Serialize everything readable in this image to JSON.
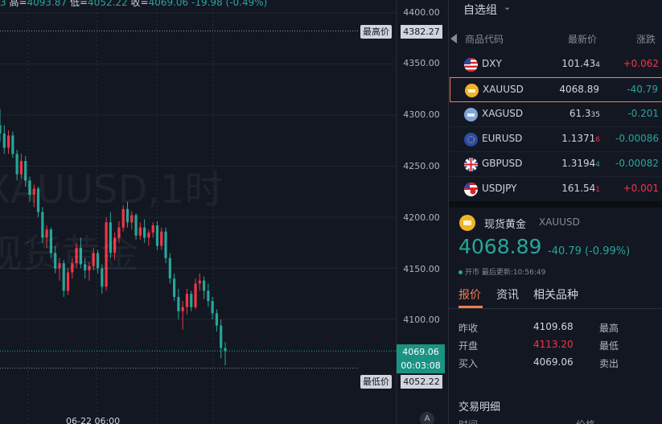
{
  "ohlc": {
    "partial_lead": "3",
    "high_label": "高=",
    "high": "4093.87",
    "low_label": "低=",
    "low": "4052.22",
    "close_label": "收=",
    "close": "4069.06",
    "change": "-19.98",
    "change_pct": "(-0.49%)"
  },
  "watermark": {
    "line1": "XAUUSD,1时",
    "line2": "现货黄金"
  },
  "price_axis": {
    "ticks": [
      "4400.00",
      "4350.00",
      "4300.00",
      "4250.00",
      "4200.00",
      "4150.00",
      "4100.00"
    ],
    "high_tag_label": "最高价",
    "high_tag_value": "4382.27",
    "low_tag_label": "最低价",
    "low_tag_value": "4052.22",
    "current_price": "4069.06",
    "countdown": "00:03:08",
    "time_label": "06-22 06:00",
    "auto_button": "A"
  },
  "chart_data": {
    "type": "candlestick",
    "symbol": "XAUUSD",
    "interval": "1时",
    "ylim": [
      4050,
      4410
    ],
    "yticks": [
      4100,
      4150,
      4200,
      4250,
      4300,
      4350,
      4400
    ],
    "series": [
      {
        "values": [
          [
            4290,
            4306,
            4274,
            4282
          ],
          [
            4282,
            4290,
            4262,
            4268
          ],
          [
            4268,
            4285,
            4262,
            4280
          ],
          [
            4280,
            4284,
            4258,
            4262
          ],
          [
            4262,
            4266,
            4236,
            4242
          ],
          [
            4242,
            4262,
            4238,
            4255
          ],
          [
            4255,
            4260,
            4230,
            4236
          ],
          [
            4236,
            4240,
            4215,
            4222
          ],
          [
            4222,
            4232,
            4210,
            4228
          ],
          [
            4228,
            4230,
            4200,
            4205
          ],
          [
            4205,
            4210,
            4175,
            4180
          ],
          [
            4180,
            4192,
            4170,
            4188
          ],
          [
            4188,
            4190,
            4160,
            4165
          ],
          [
            4165,
            4172,
            4145,
            4150
          ],
          [
            4150,
            4160,
            4138,
            4155
          ],
          [
            4155,
            4158,
            4122,
            4128
          ],
          [
            4128,
            4150,
            4124,
            4146
          ],
          [
            4146,
            4160,
            4140,
            4155
          ],
          [
            4155,
            4175,
            4150,
            4170
          ],
          [
            4170,
            4180,
            4150,
            4154
          ],
          [
            4154,
            4160,
            4140,
            4148
          ],
          [
            4148,
            4156,
            4138,
            4152
          ],
          [
            4152,
            4170,
            4148,
            4165
          ],
          [
            4165,
            4168,
            4145,
            4150
          ],
          [
            4150,
            4154,
            4125,
            4132
          ],
          [
            4132,
            4200,
            4128,
            4195
          ],
          [
            4195,
            4205,
            4160,
            4165
          ],
          [
            4165,
            4185,
            4158,
            4180
          ],
          [
            4180,
            4196,
            4175,
            4190
          ],
          [
            4190,
            4212,
            4186,
            4208
          ],
          [
            4208,
            4215,
            4190,
            4195
          ],
          [
            4195,
            4206,
            4188,
            4202
          ],
          [
            4202,
            4204,
            4178,
            4182
          ],
          [
            4182,
            4195,
            4178,
            4190
          ],
          [
            4190,
            4198,
            4175,
            4180
          ],
          [
            4180,
            4188,
            4172,
            4185
          ],
          [
            4185,
            4195,
            4180,
            4192
          ],
          [
            4192,
            4196,
            4168,
            4172
          ],
          [
            4172,
            4190,
            4168,
            4186
          ],
          [
            4186,
            4190,
            4155,
            4160
          ],
          [
            4160,
            4165,
            4135,
            4140
          ],
          [
            4140,
            4145,
            4118,
            4122
          ],
          [
            4122,
            4130,
            4100,
            4108
          ],
          [
            4108,
            4118,
            4090,
            4112
          ],
          [
            4112,
            4130,
            4105,
            4125
          ],
          [
            4125,
            4128,
            4108,
            4112
          ],
          [
            4112,
            4140,
            4110,
            4135
          ],
          [
            4135,
            4145,
            4128,
            4138
          ],
          [
            4138,
            4142,
            4120,
            4128
          ],
          [
            4128,
            4135,
            4112,
            4118
          ],
          [
            4118,
            4122,
            4100,
            4106
          ],
          [
            4106,
            4110,
            4088,
            4094
          ],
          [
            4094,
            4100,
            4062,
            4072
          ],
          [
            4072,
            4078,
            4055,
            4069
          ]
        ]
      }
    ],
    "high_marker": 4382.27,
    "low_marker": 4052.22,
    "last_price": 4069.06
  },
  "watchlist": {
    "title": "自选组",
    "headers": {
      "symbol": "商品代码",
      "last": "最新价",
      "change": "涨跌"
    },
    "rows": [
      {
        "symbol": "DXY",
        "last_main": "101.43",
        "last_tail": "4",
        "change": "+0.062",
        "dir": "up",
        "icon": "us-flag-icon"
      },
      {
        "symbol": "XAUUSD",
        "last_main": "4068.89",
        "last_tail": "",
        "change": "-40.79",
        "dir": "dn",
        "icon": "gold-icon"
      },
      {
        "symbol": "XAGUSD",
        "last_main": "61.3",
        "last_tail": "35",
        "change": "-0.201",
        "dir": "dn",
        "icon": "silver-icon"
      },
      {
        "symbol": "EURUSD",
        "last_main": "1.1371",
        "last_tail": "6",
        "change": "-0.00086",
        "dir": "dn",
        "icon": "eu-us-flag-icon"
      },
      {
        "symbol": "GBPUSD",
        "last_main": "1.3194",
        "last_tail": "4",
        "change": "-0.00082",
        "dir": "dn",
        "icon": "gb-us-flag-icon"
      },
      {
        "symbol": "USDJPY",
        "last_main": "161.54",
        "last_tail": "1",
        "change": "+0.001",
        "dir": "up",
        "icon": "us-jp-flag-icon"
      }
    ]
  },
  "detail": {
    "name": "现货黄金",
    "code": "XAUUSD",
    "price": "4068.89",
    "change": "-40.79 (-0.99%)",
    "status": "开市",
    "updated": "最后更新:10:56:49",
    "tabs": [
      "报价",
      "资讯",
      "相关品种"
    ],
    "quote": {
      "prev_close_label": "昨收",
      "prev_close": "4109.68",
      "high_label": "最高",
      "open_label": "开盘",
      "open": "4113.20",
      "low_label": "最低",
      "bid_label": "买入",
      "bid": "4069.06",
      "ask_label": "卖出"
    },
    "trades_title": "交易明细",
    "trades_headers": {
      "time": "时间",
      "price": "价格"
    }
  },
  "colors": {
    "up": "#f23645",
    "down": "#26a69a",
    "accent": "#f57c50",
    "bg": "#131722"
  }
}
